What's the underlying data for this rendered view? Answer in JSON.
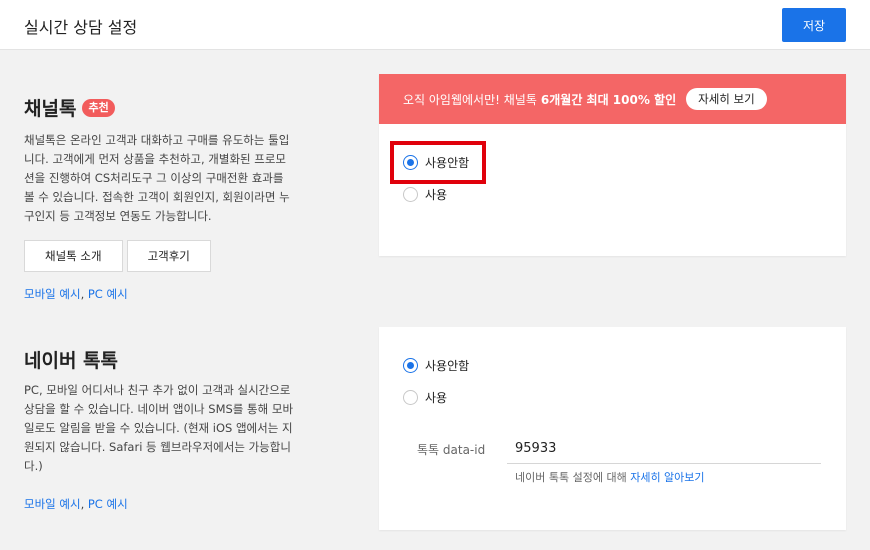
{
  "header": {
    "title": "실시간 상담 설정",
    "save_label": "저장"
  },
  "channeltalk": {
    "title": "채널톡",
    "badge": "추천",
    "description": "채널톡은 온라인 고객과 대화하고 구매를 유도하는 툴입니다. 고객에게 먼저 상품을 추천하고, 개별화된 프로모션을 진행하여 CS처리도구 그 이상의 구매전환 효과를 볼 수 있습니다. 접속한 고객이 회원인지, 회원이라면 누구인지 등 고객정보 연동도 가능합니다.",
    "intro_button": "채널톡 소개",
    "review_button": "고객후기",
    "mobile_link": "모바일 예시",
    "separator": ",",
    "pc_link": "PC 예시",
    "promo": {
      "text": "오직 아임웹에서만! 채널톡",
      "highlight": "6개월간 최대 100% 할인",
      "button": "자세히 보기"
    },
    "options": [
      "사용안함",
      "사용"
    ],
    "selected": "사용안함"
  },
  "naver": {
    "title": "네이버 톡톡",
    "description": "PC, 모바일 어디서나 친구 추가 없이 고객과 실시간으로 상담을 할 수 있습니다. 네이버 앱이나 SMS를 통해 모바일로도 알림을 받을 수 있습니다. (현재 iOS 앱에서는 지원되지 않습니다. Safari 등 웹브라우저에서는 가능합니다.)",
    "mobile_link": "모바일 예시",
    "separator": ",",
    "pc_link": "PC 예시",
    "options": [
      "사용안함",
      "사용"
    ],
    "selected": "사용안함",
    "field_label": "톡톡 data-id",
    "field_value": "95933",
    "help_text": "네이버 톡톡 설정에 대해",
    "help_link": "자세히 알아보기"
  },
  "colors": {
    "accent": "#1a73e8",
    "promo": "#f46666",
    "badge": "#f25c5c",
    "highlight": "#e0000b"
  }
}
